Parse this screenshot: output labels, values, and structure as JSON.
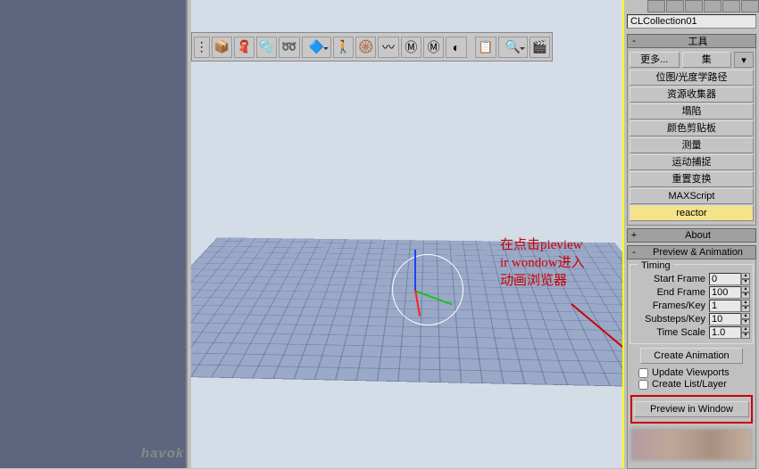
{
  "collection_name": "CLCollection01",
  "rollouts": {
    "tools": "工具",
    "about": "About",
    "preview": "Preview & Animation"
  },
  "tools": {
    "more": "更多...",
    "sets": "集",
    "buttons": [
      "位图/光度学路径",
      "资源收集器",
      "塌陷",
      "颜色剪贴板",
      "测量",
      "运动捕捉",
      "重置变换",
      "MAXScript",
      "reactor"
    ]
  },
  "timing": {
    "group": "Timing",
    "start_lbl": "Start Frame",
    "start_val": "0",
    "end_lbl": "End Frame",
    "end_val": "100",
    "fpk_lbl": "Frames/Key",
    "fpk_val": "1",
    "spk_lbl": "Substeps/Key",
    "spk_val": "10",
    "scale_lbl": "Time Scale",
    "scale_val": "1.0"
  },
  "create_animation": "Create Animation",
  "update_vp": "Update Viewports",
  "create_list": "Create List/Layer",
  "preview_window": "Preview in Window",
  "annotation": "在点击pieview\nir wondow进入\n动画浏览器",
  "logo": "havok",
  "chart_data": null
}
